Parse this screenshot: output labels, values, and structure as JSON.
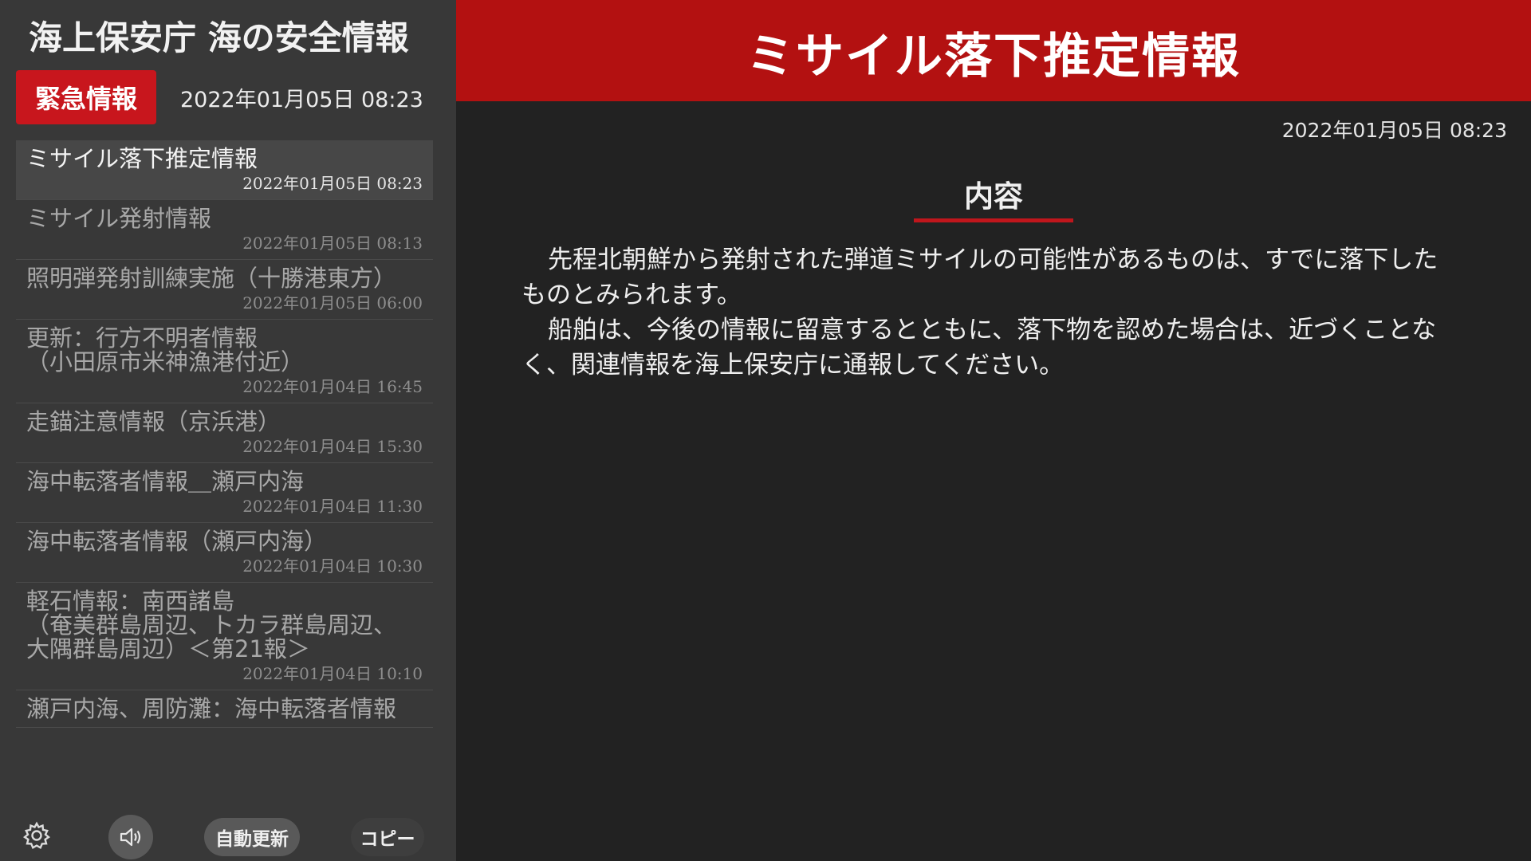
{
  "sidebar": {
    "app_title": "海上保安庁 海の安全情報",
    "emergency_label": "緊急情報",
    "emergency_time": "2022年01月05日 08:23",
    "items": [
      {
        "title": "ミサイル落下推定情報",
        "time": "2022年01月05日 08:23",
        "selected": true
      },
      {
        "title": "ミサイル発射情報",
        "time": "2022年01月05日 08:13"
      },
      {
        "title": "照明弾発射訓練実施（十勝港東方）",
        "time": "2022年01月05日 06:00"
      },
      {
        "title": "更新：行方不明者情報\n（小田原市米神漁港付近）",
        "time": "2022年01月04日 16:45"
      },
      {
        "title": "走錨注意情報（京浜港）",
        "time": "2022年01月04日 15:30"
      },
      {
        "title": "海中転落者情報＿瀬戸内海",
        "time": "2022年01月04日 11:30"
      },
      {
        "title": "海中転落者情報（瀬戸内海）",
        "time": "2022年01月04日 10:30"
      },
      {
        "title": "軽石情報：南西諸島\n（奄美群島周辺、トカラ群島周辺、\n大隅群島周辺）＜第21報＞",
        "time": "2022年01月04日 10:10"
      },
      {
        "title": "瀬戸内海、周防灘：海中転落者情報",
        "time": ""
      }
    ],
    "toolbar": {
      "settings_icon": "gear-icon",
      "sound_icon": "speaker-icon",
      "auto_update_label": "自動更新",
      "copy_label": "コピー"
    }
  },
  "main": {
    "title": "ミサイル落下推定情報",
    "time": "2022年01月05日 08:23",
    "section_heading": "内容",
    "paragraphs": [
      "先程北朝鮮から発射された弾道ミサイルの可能性があるものは、すでに落下したものとみられます。",
      "船舶は、今後の情報に留意するとともに、落下物を認めた場合は、近づくことなく、関連情報を海上保安庁に通報してください。"
    ]
  },
  "colors": {
    "header_red": "#b31111",
    "badge_red": "#c8161d",
    "sidebar_bg": "#383838",
    "main_bg": "#222222"
  }
}
